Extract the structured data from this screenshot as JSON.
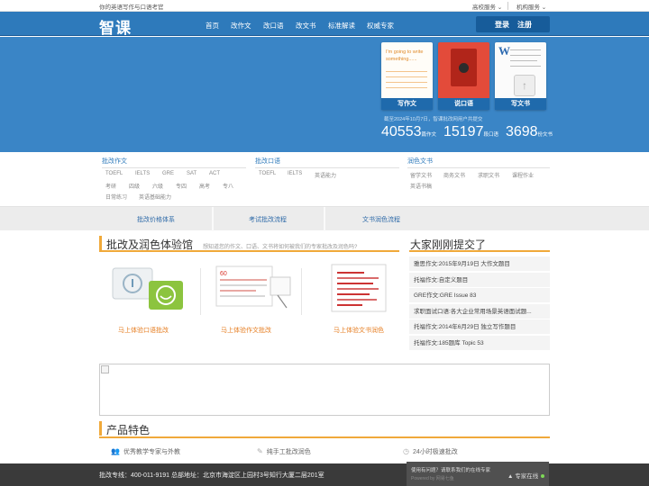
{
  "topbar": {
    "tagline": "你的英语写作与口语考官",
    "school_service": "高校服务 ⌄",
    "org_service": "机构服务 ⌄"
  },
  "nav": {
    "logo": "智课",
    "links": [
      "首页",
      "改作文",
      "改口语",
      "改文书",
      "标准解读",
      "权威专家"
    ],
    "login": "登录",
    "register": "注册"
  },
  "hero": {
    "cards": [
      {
        "caption": "写作文",
        "sample_text": "I'm going to write something......"
      },
      {
        "caption": "说口语"
      },
      {
        "caption": "写文书",
        "letter": "W"
      }
    ],
    "stat_note": "截至2024年10月7日，智课批改网用户共提交",
    "stats": [
      {
        "num": "40553",
        "unit": "篇作文"
      },
      {
        "num": "15197",
        "unit": "段口语"
      },
      {
        "num": "3698",
        "unit": "份文书"
      }
    ]
  },
  "categories": [
    {
      "title": "批改作文",
      "items": [
        "TOEFL",
        "IELTS",
        "GRE",
        "SAT",
        "ACT",
        "考研",
        "四级",
        "六级",
        "专四",
        "高考",
        "专八",
        "日常练习",
        "英语基础能力"
      ]
    },
    {
      "title": "批改口语",
      "items": [
        "TOEFL",
        "IELTS",
        "英语能力"
      ]
    },
    {
      "title": "润色文书",
      "items": [
        "留学文书",
        "商务文书",
        "求职文书",
        "课程作业",
        "英语书稿"
      ]
    }
  ],
  "flows": [
    "批改价格体系",
    "考试批改流程",
    "文书润色流程"
  ],
  "experience": {
    "title": "批改及润色体验馆",
    "subtitle": "想知道您的作文、口语、文书将如何被我们的专家批改及润色吗?",
    "items": [
      "马上体验口语批改",
      "马上体验作文批改",
      "马上体验文书润色"
    ]
  },
  "recent": {
    "title": "大家刚刚提交了",
    "items": [
      "雅思作文:2015年9月19日 大作文题目",
      "托福作文:自定义题目",
      "GRE作文:GRE Issue 83",
      "求职面试口语:各大企业常用场景英语面试题...",
      "托福作文:2014年6月29日 独立写作题目",
      "托福作文:185题库 Topic 53"
    ]
  },
  "features": {
    "title": "产品特色",
    "items": [
      {
        "icon": "people-icon",
        "label": "优秀教学专家与外教"
      },
      {
        "icon": "pen-icon",
        "label": "纯手工批改润色"
      },
      {
        "icon": "clock-icon",
        "label": "24小时极速批改"
      }
    ]
  },
  "footer": {
    "address": "批改专线：400-011-9191 总部地址：北京市海淀区上园村3号知行大厦二层201室",
    "chat_question": "使用有问题？请联系我们的在线专家",
    "chat_sub": "Powered by 网易七鱼",
    "chat_online": "▲ 专家在线"
  },
  "colors": {
    "primary": "#2e7abb",
    "accent": "#f0a93a",
    "footer": "#3a3a3a"
  }
}
